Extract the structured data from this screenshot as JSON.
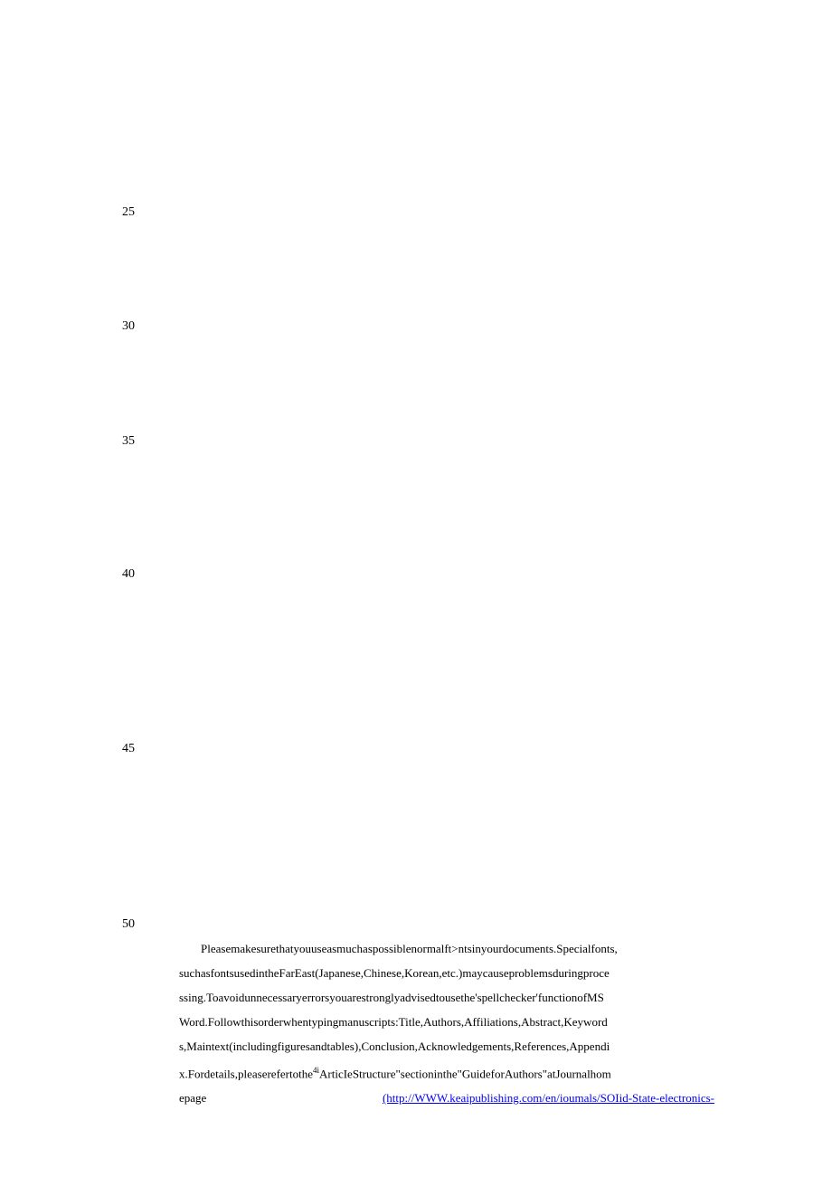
{
  "lineNumbers": {
    "n25": "25",
    "n30": "30",
    "n35": "35",
    "n40": "40",
    "n45": "45",
    "n50": "50"
  },
  "paragraph": {
    "part1": "Pleasemakesurethatyouuseasmuchaspossiblenormalft>ntsinyourdocuments.Specialfonts, suchasfontsusedintheFarEast(Japanese,Chinese,Korean,etc.)maycauseproblemsduringproce ssing.Toavoidunnecessaryerrorsyouarestronglyadvisedtousethe'spellchecker'functionofMS Word.Followthisorderwhentypingmanuscripts:Title,Authors,Affiliations,Abstract,Keyword s,Maintext(includingfiguresandtables),Conclusion,Acknowledgements,References,Appendi x.Fordetails,pleaserefertothe",
    "sup": "4i",
    "part2": "ArticIeStructure\"sectioninthe\"GuideforAuthors\"atJournalhom",
    "epageLabel": "epage",
    "linkText": "(http://WWW.keaipublishing.com/en/ioumals/SOIid-State-electronics-"
  }
}
